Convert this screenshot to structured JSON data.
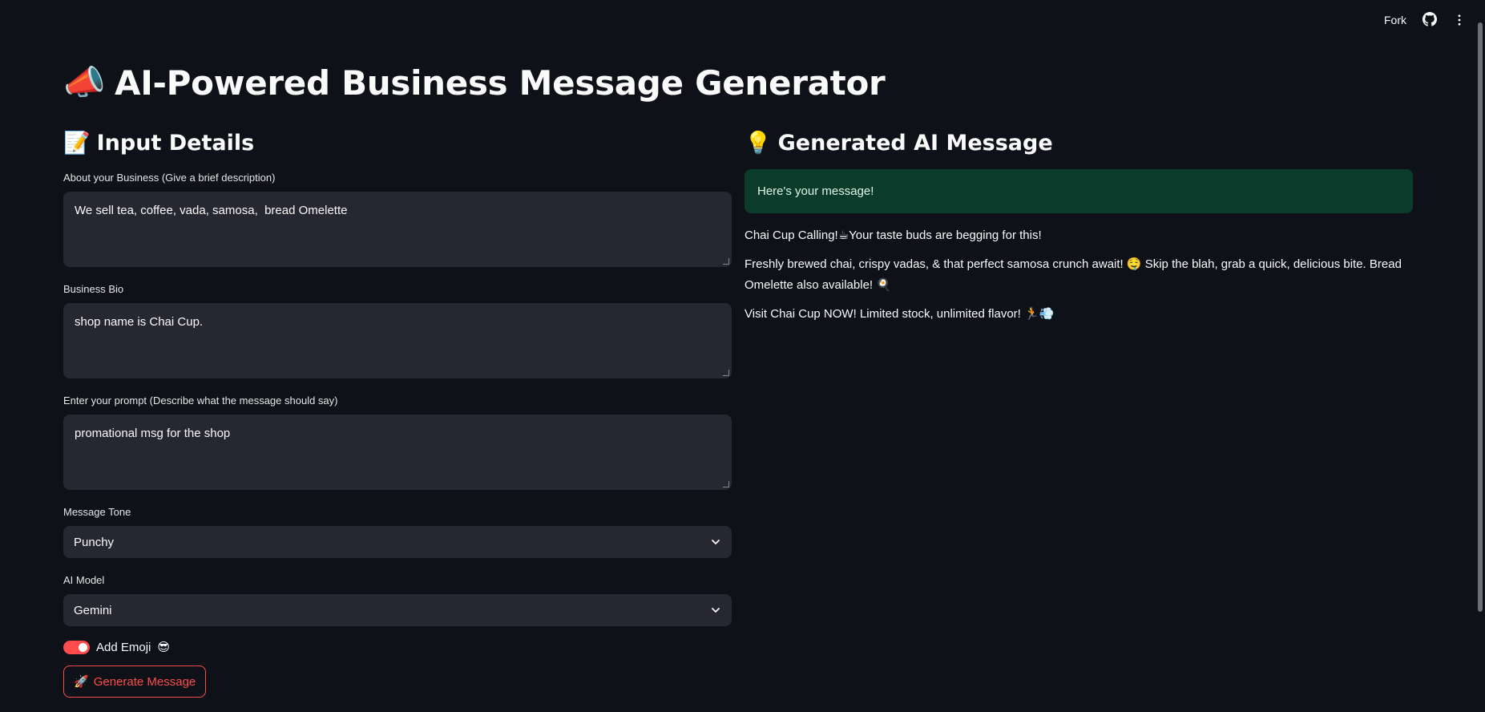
{
  "topbar": {
    "fork_label": "Fork"
  },
  "page": {
    "title": "AI-Powered Business Message Generator",
    "title_emoji": "📣"
  },
  "input_section": {
    "title": "Input Details",
    "title_emoji": "📝",
    "about": {
      "label": "About your Business (Give a brief description)",
      "value": "We sell tea, coffee, vada, samosa,  bread Omelette"
    },
    "bio": {
      "label": "Business Bio",
      "value": "shop name is Chai Cup."
    },
    "prompt": {
      "label": "Enter your prompt (Describe what the message should say)",
      "value": "promational msg for the shop"
    },
    "tone": {
      "label": "Message Tone",
      "value": "Punchy"
    },
    "model": {
      "label": "AI Model",
      "value": "Gemini"
    },
    "emoji_toggle": {
      "label": "Add Emoji",
      "emoji": "😎",
      "checked": true
    },
    "generate_button": {
      "label": "Generate Message",
      "emoji": "🚀"
    }
  },
  "output_section": {
    "title": "Generated AI Message",
    "title_emoji": "💡",
    "success_text": "Here's your message!",
    "paragraphs": [
      "Chai Cup Calling!☕Your taste buds are begging for this!",
      "Freshly brewed chai, crispy vadas, & that perfect samosa crunch await! 🤤 Skip the blah, grab a quick, delicious bite. Bread Omelette also available! 🍳",
      "Visit Chai Cup NOW! Limited stock, unlimited flavor! 🏃💨"
    ]
  },
  "colors": {
    "background": "#0e1117",
    "input_bg": "#262730",
    "accent": "#ff4b4b",
    "success_bg": "#0b3b2a"
  }
}
